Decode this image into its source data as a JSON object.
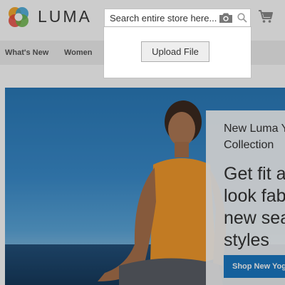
{
  "header": {
    "logo_text": "LUMA",
    "search": {
      "placeholder": "Search entire store here..."
    }
  },
  "icons": {
    "camera": "camera-icon",
    "search": "search-icon",
    "cart": "cart-icon",
    "logo": "luma-logo-icon"
  },
  "upload": {
    "button_label": "Upload File"
  },
  "nav": {
    "items": [
      {
        "label": "What's New"
      },
      {
        "label": "Women"
      }
    ]
  },
  "hero": {
    "kicker": [
      "New Luma Y",
      "Collection"
    ],
    "headline": [
      "Get fit ar",
      "look fab",
      "new seas",
      "styles"
    ],
    "cta": "Shop New Yoga"
  },
  "colors": {
    "accent": "#1979c3",
    "overlay": "rgba(0,0,0,0.20)"
  }
}
